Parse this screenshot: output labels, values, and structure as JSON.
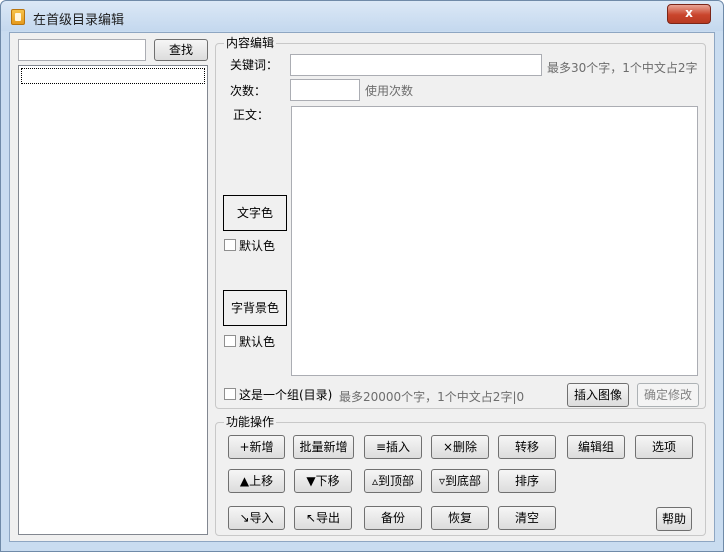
{
  "window": {
    "title": "在首级目录编辑",
    "close_glyph": "x"
  },
  "left_panel": {
    "search_value": "",
    "find_label": "查找"
  },
  "content_edit": {
    "legend": "内容编辑",
    "keyword_label": "关键词：",
    "keyword_value": "",
    "keyword_hint": "最多30个字，1个中文占2字",
    "count_label": "次数：",
    "count_value": "",
    "count_hint": "使用次数",
    "body_label": "正文：",
    "body_value": "",
    "text_color_label": "文字色",
    "text_default_label": "默认色",
    "bg_color_label": "字背景色",
    "bg_default_label": "默认色",
    "is_group_label": "这是一个组(目录)",
    "status_text": "最多20000个字，1个中文占2字|0",
    "insert_image_label": "插入图像",
    "confirm_label": "确定修改"
  },
  "functions": {
    "legend": "功能操作",
    "add": "+新增",
    "batch_add": "批量新增",
    "insert": "≡插入",
    "delete": "×删除",
    "move": "转移",
    "edit_group": "编辑组",
    "options": "选项",
    "move_up": "▲上移",
    "move_down": "▼下移",
    "to_top": "▵到顶部",
    "to_bottom": "▿到底部",
    "sort": "排序",
    "import": "↘导入",
    "export": "↖导出",
    "backup": "备份",
    "restore": "恢复",
    "clear": "清空",
    "help": "帮助"
  }
}
